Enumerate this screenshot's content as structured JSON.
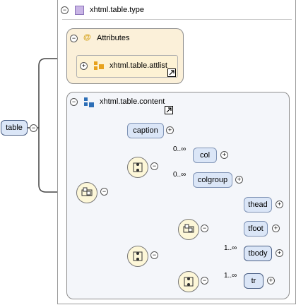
{
  "root_element": {
    "label": "table"
  },
  "complex_type": {
    "label": "xhtml.table.type"
  },
  "attributes": {
    "label": "Attributes",
    "icon": "at-icon"
  },
  "attlist": {
    "label": "xhtml.table.attlist"
  },
  "content_group": {
    "label": "xhtml.table.content"
  },
  "elements": {
    "caption": "caption",
    "col": "col",
    "colgroup": "colgroup",
    "thead": "thead",
    "tfoot": "tfoot",
    "tbody": "tbody",
    "tr": "tr"
  },
  "cardinality": {
    "col": "0..∞",
    "colgroup": "0..∞",
    "tbody": "1..∞",
    "tr": "1..∞"
  },
  "symbols": {
    "collapse": "−",
    "expand": "+",
    "at": "@"
  },
  "colors": {
    "element_fill": "#dbe6f7",
    "attribute_fill": "#fbf0d9",
    "compositor_fill": "#fdf7d8",
    "group_fill": "#f4f6fa"
  }
}
